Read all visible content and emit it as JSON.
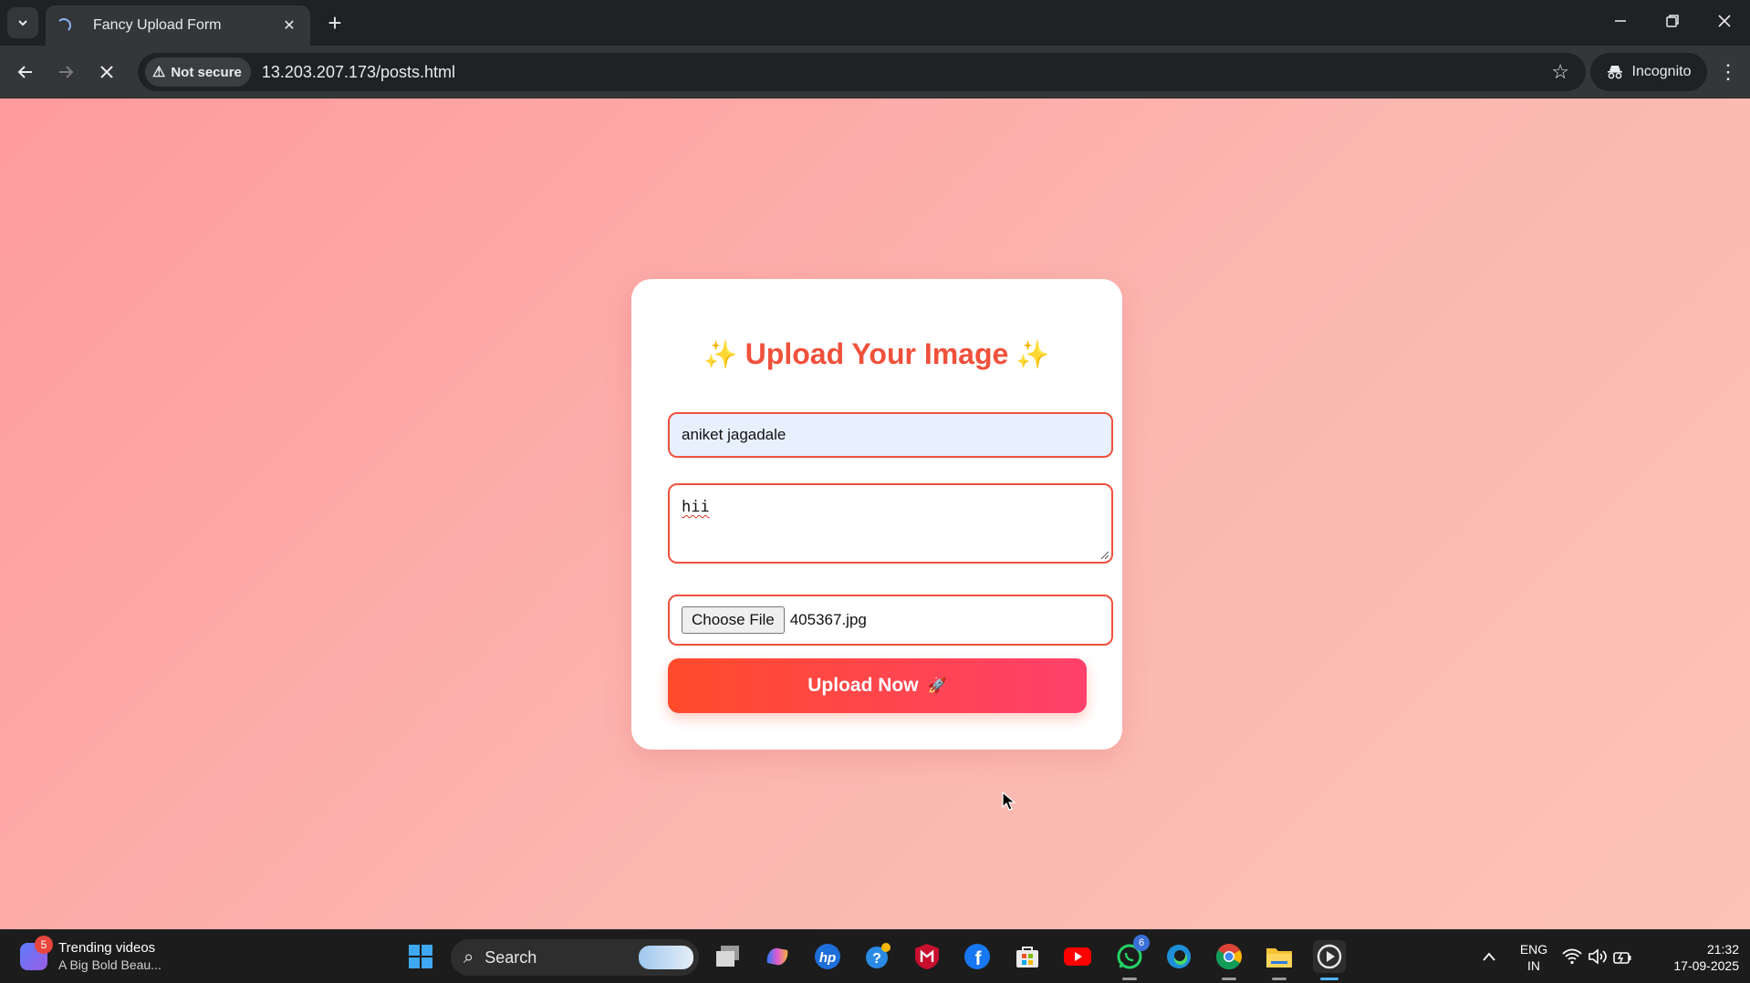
{
  "browser": {
    "tab_title": "Fancy Upload Form",
    "security_label": "Not secure",
    "url": "13.203.207.173/posts.html",
    "profile_label": "Incognito"
  },
  "form": {
    "title": "Upload Your Image",
    "title_emoji": "✨",
    "name_value": "aniket jagadale",
    "message_value": "hii",
    "choose_file_label": "Choose File",
    "file_name": "405367.jpg",
    "submit_label": "Upload Now",
    "submit_emoji": "🚀"
  },
  "taskbar": {
    "news_title": "Trending videos",
    "news_subtitle": "A Big Bold Beau...",
    "news_badge": "5",
    "search_label": "Search",
    "whatsapp_badge": "6",
    "lang_top": "ENG",
    "lang_bottom": "IN",
    "time": "21:32",
    "date": "17-09-2025"
  },
  "colors": {
    "accent": "#f0513c",
    "button_start": "#ff4b2b",
    "button_end": "#ff416c",
    "name_field_bg": "#e8f0fe"
  },
  "icons": [
    "tab-list-icon",
    "loading-spinner-icon",
    "close-icon",
    "plus-icon",
    "minimize-icon",
    "restore-icon",
    "window-close-icon",
    "back-arrow-icon",
    "forward-arrow-icon",
    "stop-loading-icon",
    "warning-icon",
    "star-icon",
    "incognito-icon",
    "more-menu-icon",
    "sparkles-icon",
    "rocket-icon",
    "windows-start-icon",
    "search-icon",
    "wifi-icon",
    "speaker-icon",
    "battery-icon"
  ]
}
